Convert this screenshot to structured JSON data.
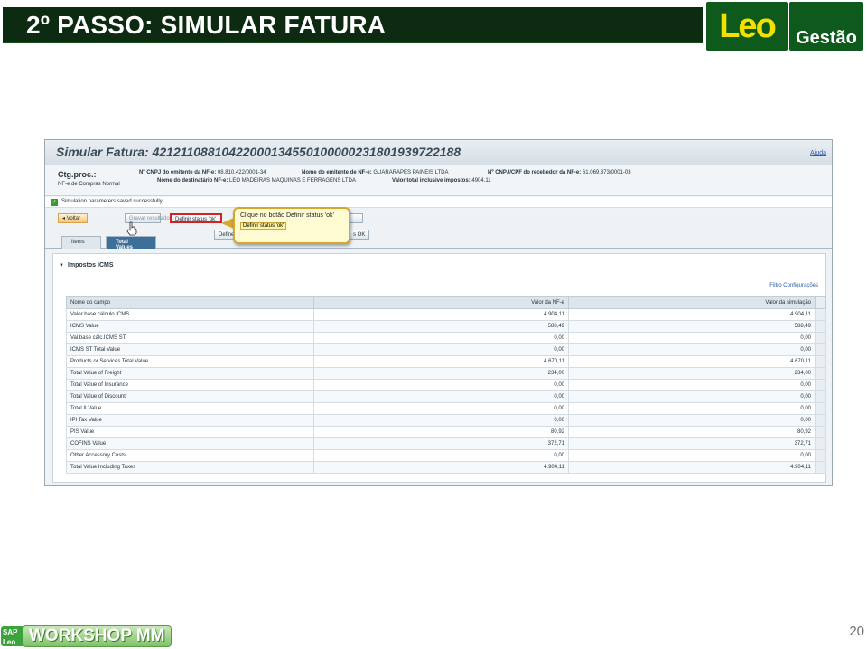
{
  "slide": {
    "title": "2º PASSO: SIMULAR FATURA",
    "logo_main": "Leo",
    "logo_sub": "Gestão",
    "footer_brand": "WORKSHOP MM",
    "footer_badge": "SAP Leo",
    "page_number": "20"
  },
  "sap": {
    "title": "Simular Fatura: 4212110881042200013455010000023180193972218​8",
    "help": "Ajuda",
    "ctg_label": "Ctg.proc.:",
    "ctg_value": "NF-e de Compras Normal",
    "fields": {
      "cnpj_emitente_label": "Nº CNPJ do emitente da NF-e:",
      "cnpj_emitente_value": "08.810.422/0001-34",
      "nome_emitente_label": "Nome do emitente de NF-e:",
      "nome_emitente_value": "GUARARAPES PAINEIS LTDA",
      "cnpj_recebedor_label": "Nº CNPJ/CPF do recebedor da NF-e:",
      "cnpj_recebedor_value": "61.069.373/0001-03",
      "nome_destinatario_label": "Nome do destinatário NF-e:",
      "nome_destinatario_value": "LEO MADEIRAS MAQUINAS E FERRAGENS LTDA",
      "valor_total_label": "Valor total inclusive impostos:",
      "valor_total_value": "4904.11"
    },
    "message": "Simulation parameters saved successfully",
    "toolbar": {
      "back": "Voltar",
      "save_results": "Gravar resultados",
      "set_status_ok": "Definir status 'ok'",
      "define_partial": "Define",
      "ok_partial": "s OK",
      "hidden_partial": "o"
    },
    "tooltip": {
      "line1": "Clique no botão Definir status 'ok'",
      "line2": "Definir status 'ok'"
    },
    "tabs": [
      "Items",
      "Total Values"
    ],
    "section_title": "Impostos ICMS",
    "filter_link": "Filtro Configurações",
    "table": {
      "headers": [
        "Nome do campo",
        "Valor da NF-e",
        "Valor da simulação"
      ],
      "rows": [
        [
          "Valor base cálculo ICMS",
          "4.904,11",
          "4.904,11"
        ],
        [
          "ICMS Value",
          "588,49",
          "588,49"
        ],
        [
          "Val.base cálc.ICMS ST",
          "0,00",
          "0,00"
        ],
        [
          "ICMS ST Total Value",
          "0,00",
          "0,00"
        ],
        [
          "Products or Services Total Value",
          "4.670,11",
          "4.670,11"
        ],
        [
          "Total Value of Freight",
          "234,00",
          "234,00"
        ],
        [
          "Total Value of Insurance",
          "0,00",
          "0,00"
        ],
        [
          "Total Value of Discount",
          "0,00",
          "0,00"
        ],
        [
          "Total II Value",
          "0,00",
          "0,00"
        ],
        [
          "IPI Tax Value",
          "0,00",
          "0,00"
        ],
        [
          "PIS Value",
          "80,92",
          "80,92"
        ],
        [
          "COFINS Value",
          "372,71",
          "372,71"
        ],
        [
          "Other Accessory Costs",
          "0,00",
          "0,00"
        ],
        [
          "Total Value Including Taxes",
          "4.904,11",
          "4.904,11"
        ]
      ]
    }
  },
  "colors": {
    "title_bar": "#0d2b10",
    "logo_green": "#0d5a1c",
    "logo_yellow": "#f4e000",
    "highlight_red": "#d62020",
    "tab_active": "#3d6f9b"
  }
}
